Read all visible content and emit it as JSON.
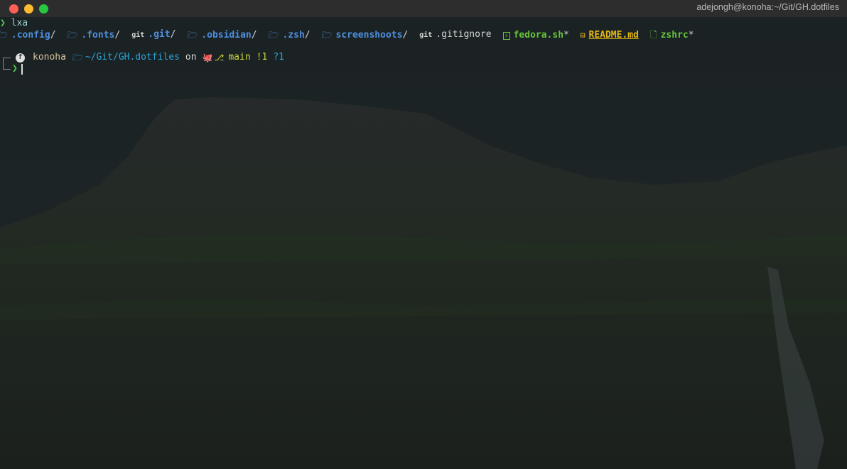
{
  "window": {
    "title": "adejongh@konoha:~/Git/GH.dotfiles"
  },
  "colors": {
    "close": "#fe5f57",
    "minimize": "#febc2e",
    "maximize": "#28c840",
    "prompt_green": "#4fd04f",
    "directory_blue": "#4e8fe0",
    "executable_green": "#68c23b",
    "readme_yellow": "#e2b714",
    "path_cyan": "#2ba3d6",
    "branch_yellow": "#c7d43b"
  },
  "history": {
    "prompt_symbol": "❯",
    "command": "lxa"
  },
  "listing": [
    {
      "icon": "folder-open-icon",
      "name": ".config",
      "suffix": "/"
    },
    {
      "icon": "folder-open-icon",
      "name": ".fonts",
      "suffix": "/"
    },
    {
      "icon": "git-icon",
      "icon_text": "git",
      "name": ".git",
      "suffix": "/"
    },
    {
      "icon": "folder-open-icon",
      "name": ".obsidian",
      "suffix": "/"
    },
    {
      "icon": "folder-open-icon",
      "name": ".zsh",
      "suffix": "/"
    },
    {
      "icon": "folder-open-icon",
      "name": "screenshoots",
      "suffix": "/"
    },
    {
      "icon": "git-icon",
      "icon_text": "git",
      "name": ".gitignore",
      "suffix": ""
    },
    {
      "icon": "terminal-icon",
      "name": "fedora.sh",
      "suffix": "*"
    },
    {
      "icon": "book-icon",
      "name": "README.md",
      "suffix": ""
    },
    {
      "icon": "file-icon",
      "name": "zshrc",
      "suffix": "*"
    }
  ],
  "prompt": {
    "os_icon": "fedora-icon",
    "host": "konoha",
    "path": "~/Git/GH.dotfiles",
    "on_text": "on",
    "branch": "main",
    "modified": "!1",
    "untracked": "?1",
    "input_symbol": "❯"
  }
}
